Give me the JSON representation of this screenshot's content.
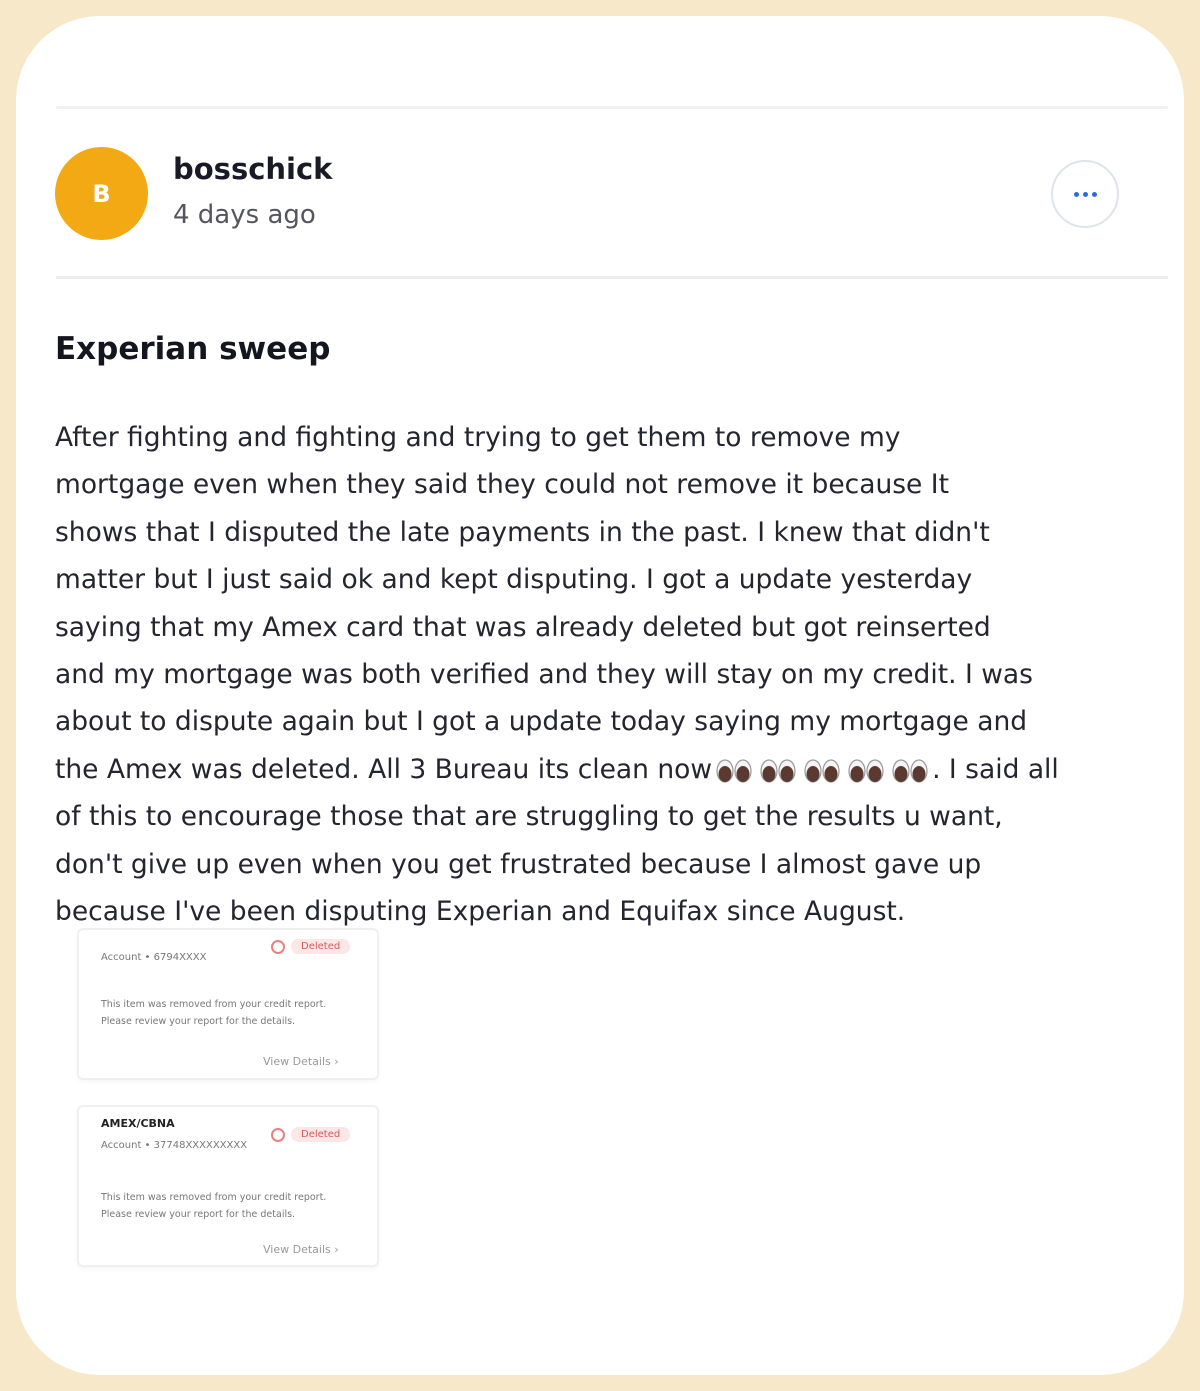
{
  "post": {
    "author": {
      "initial": "B",
      "name": "bosschick",
      "time": "4 days ago",
      "avatar_color": "#f3a914"
    },
    "more_icon": "ellipsis-icon",
    "title": "Experian sweep",
    "body_lines": [
      "After fighting and fighting and trying to get them to remove my",
      "mortgage even when they said they could not remove it because It",
      "shows that I disputed the late payments in the past. I knew that didn't",
      "matter but I just said ok and kept disputing. I got a update yesterday",
      "saying that my Amex card that was already deleted but got reinserted",
      "and my mortgage was both verified and they will stay on my credit. I was",
      "about to dispute again but I got a update today saying my mortgage and",
      "the Amex was deleted. All 3 Bureau its clean now",
      ". I said all",
      "of this to encourage those that are struggling to get the results u want,",
      "don't give up even when you get frustrated because I almost gave up",
      "because I've been disputing Experian and  Equifax since August."
    ],
    "emoji_icon": "eyes-emoji-icon",
    "emoji_count": 5
  },
  "cards": [
    {
      "name": "",
      "account": "Account • 6794XXXX",
      "status": "Deleted",
      "status_icon": "deleted-icon",
      "text_1": "This item was removed from your credit report.",
      "text_2": "Please review your report for the details.",
      "link": "View Details",
      "link_icon": "chevron-right-icon"
    },
    {
      "name": "AMEX/CBNA",
      "account": "Account • 37748XXXXXXXXX",
      "status": "Deleted",
      "status_icon": "deleted-icon",
      "text_1": "This item was removed from your credit report.",
      "text_2": "Please review your report for the details.",
      "link": "View Details",
      "link_icon": "chevron-right-icon"
    }
  ]
}
